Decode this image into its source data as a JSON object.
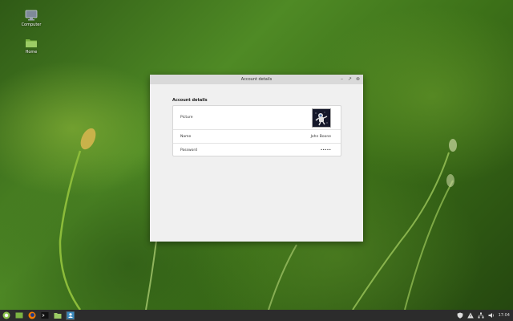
{
  "desktop": {
    "icons": [
      {
        "label": "Computer",
        "icon": "computer-icon"
      },
      {
        "label": "Home",
        "icon": "folder-icon"
      }
    ]
  },
  "window": {
    "title": "Account details",
    "section_title": "Account details",
    "rows": [
      {
        "label": "Picture",
        "value": ""
      },
      {
        "label": "Name",
        "value": "John Boone"
      },
      {
        "label": "Password",
        "value": "•••••"
      }
    ],
    "controls": {
      "minimize": "–",
      "maximize": "↗",
      "close": "⊗"
    }
  },
  "taskbar": {
    "clock": "17:04",
    "launchers": [
      "menu-icon",
      "files-icon",
      "firefox-icon",
      "terminal-icon",
      "folder-icon",
      "users-icon"
    ],
    "tray": [
      "shield-icon",
      "warning-icon",
      "network-icon",
      "volume-icon"
    ]
  },
  "colors": {
    "taskbar": "#2c2c2c",
    "accent": "#8bc34a",
    "window_bg": "#f0f0f0"
  }
}
